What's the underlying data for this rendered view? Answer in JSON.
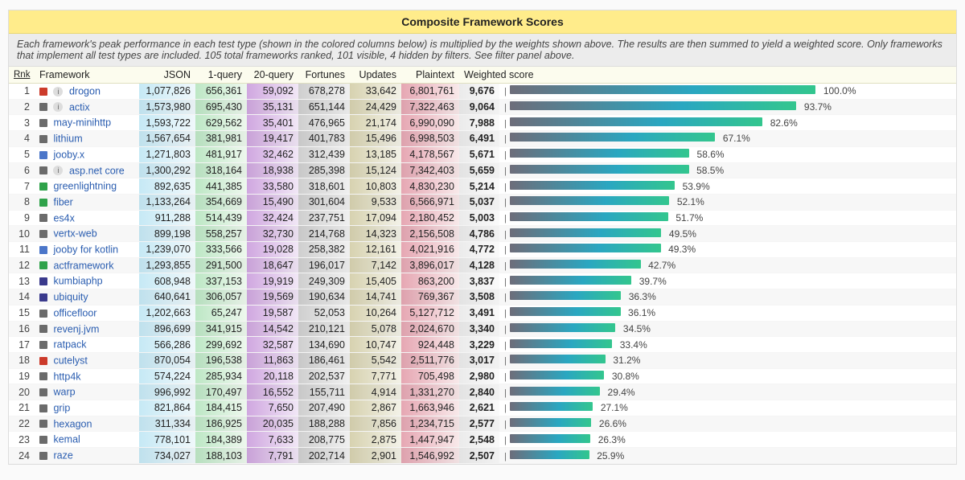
{
  "title": "Composite Framework Scores",
  "description_prefix": "Each framework's peak performance in each test type (shown in the colored columns below) is multiplied by the weights shown above. The results are then summed to yield a weighted score. Only frameworks that implement all test types are included.",
  "description_stats": "105 total frameworks ranked, 101 visible, 4 hidden by filters. See filter panel above.",
  "columns": {
    "rank": "Rnk",
    "framework": "Framework",
    "json": "JSON",
    "one_query": "1-query",
    "twenty_query": "20-query",
    "fortunes": "Fortunes",
    "updates": "Updates",
    "plaintext": "Plaintext",
    "weighted": "Weighted score"
  },
  "chart_data": {
    "type": "bar",
    "title": "Composite Framework Scores",
    "xlabel": "",
    "ylabel": "Weighted score",
    "series_columns": [
      "JSON",
      "1-query",
      "20-query",
      "Fortunes",
      "Updates",
      "Plaintext",
      "Weighted score",
      "Percent"
    ],
    "rows": [
      {
        "rank": 1,
        "swatch": "#cc3b2b",
        "name": "drogon",
        "json": 1077826,
        "one_query": 656361,
        "twenty_query": 59092,
        "fortunes": 678278,
        "updates": 33642,
        "plaintext": 6801761,
        "weighted": 9676,
        "pct": 100.0
      },
      {
        "rank": 2,
        "swatch": "#6b6b6b",
        "name": "actix",
        "json": 1573980,
        "one_query": 695430,
        "twenty_query": 35131,
        "fortunes": 651144,
        "updates": 24429,
        "plaintext": 7322463,
        "weighted": 9064,
        "pct": 93.7
      },
      {
        "rank": 3,
        "swatch": "#6b6b6b",
        "name": "may-minihttp",
        "json": 1593722,
        "one_query": 629562,
        "twenty_query": 35401,
        "fortunes": 476965,
        "updates": 21174,
        "plaintext": 6990090,
        "weighted": 7988,
        "pct": 82.6
      },
      {
        "rank": 4,
        "swatch": "#6b6b6b",
        "name": "lithium",
        "json": 1567654,
        "one_query": 381981,
        "twenty_query": 19417,
        "fortunes": 401783,
        "updates": 15496,
        "plaintext": 6998503,
        "weighted": 6491,
        "pct": 67.1
      },
      {
        "rank": 5,
        "swatch": "#4b76c9",
        "name": "jooby.x",
        "json": 1271803,
        "one_query": 481917,
        "twenty_query": 32462,
        "fortunes": 312439,
        "updates": 13185,
        "plaintext": 4178567,
        "weighted": 5671,
        "pct": 58.6
      },
      {
        "rank": 6,
        "swatch": "#6b6b6b",
        "name": "asp.net core",
        "json": 1300292,
        "one_query": 318164,
        "twenty_query": 18938,
        "fortunes": 285398,
        "updates": 15124,
        "plaintext": 7342403,
        "weighted": 5659,
        "pct": 58.5
      },
      {
        "rank": 7,
        "swatch": "#2fa24a",
        "name": "greenlightning",
        "json": 892635,
        "one_query": 441385,
        "twenty_query": 33580,
        "fortunes": 318601,
        "updates": 10803,
        "plaintext": 4830230,
        "weighted": 5214,
        "pct": 53.9
      },
      {
        "rank": 8,
        "swatch": "#2fa24a",
        "name": "fiber",
        "json": 1133264,
        "one_query": 354669,
        "twenty_query": 15490,
        "fortunes": 301604,
        "updates": 9533,
        "plaintext": 6566971,
        "weighted": 5037,
        "pct": 52.1
      },
      {
        "rank": 9,
        "swatch": "#6b6b6b",
        "name": "es4x",
        "json": 911288,
        "one_query": 514439,
        "twenty_query": 32424,
        "fortunes": 237751,
        "updates": 17094,
        "plaintext": 2180452,
        "weighted": 5003,
        "pct": 51.7
      },
      {
        "rank": 10,
        "swatch": "#6b6b6b",
        "name": "vertx-web",
        "json": 899198,
        "one_query": 558257,
        "twenty_query": 32730,
        "fortunes": 214768,
        "updates": 14323,
        "plaintext": 2156508,
        "weighted": 4786,
        "pct": 49.5
      },
      {
        "rank": 11,
        "swatch": "#4b76c9",
        "name": "jooby for kotlin",
        "json": 1239070,
        "one_query": 333566,
        "twenty_query": 19028,
        "fortunes": 258382,
        "updates": 12161,
        "plaintext": 4021916,
        "weighted": 4772,
        "pct": 49.3
      },
      {
        "rank": 12,
        "swatch": "#2fa24a",
        "name": "actframework",
        "json": 1293855,
        "one_query": 291500,
        "twenty_query": 18647,
        "fortunes": 196017,
        "updates": 7142,
        "plaintext": 3896017,
        "weighted": 4128,
        "pct": 42.7
      },
      {
        "rank": 13,
        "swatch": "#3a3a8c",
        "name": "kumbiaphp",
        "json": 608948,
        "one_query": 337153,
        "twenty_query": 19919,
        "fortunes": 249309,
        "updates": 15405,
        "plaintext": 863200,
        "weighted": 3837,
        "pct": 39.7
      },
      {
        "rank": 14,
        "swatch": "#3a3a8c",
        "name": "ubiquity",
        "json": 640641,
        "one_query": 306057,
        "twenty_query": 19569,
        "fortunes": 190634,
        "updates": 14741,
        "plaintext": 769367,
        "weighted": 3508,
        "pct": 36.3
      },
      {
        "rank": 15,
        "swatch": "#6b6b6b",
        "name": "officefloor",
        "json": 1202663,
        "one_query": 65247,
        "twenty_query": 19587,
        "fortunes": 52053,
        "updates": 10264,
        "plaintext": 5127712,
        "weighted": 3491,
        "pct": 36.1
      },
      {
        "rank": 16,
        "swatch": "#6b6b6b",
        "name": "revenj.jvm",
        "json": 896699,
        "one_query": 341915,
        "twenty_query": 14542,
        "fortunes": 210121,
        "updates": 5078,
        "plaintext": 2024670,
        "weighted": 3340,
        "pct": 34.5
      },
      {
        "rank": 17,
        "swatch": "#6b6b6b",
        "name": "ratpack",
        "json": 566286,
        "one_query": 299692,
        "twenty_query": 32587,
        "fortunes": 134690,
        "updates": 10747,
        "plaintext": 924448,
        "weighted": 3229,
        "pct": 33.4
      },
      {
        "rank": 18,
        "swatch": "#cc3b2b",
        "name": "cutelyst",
        "json": 870054,
        "one_query": 196538,
        "twenty_query": 11863,
        "fortunes": 186461,
        "updates": 5542,
        "plaintext": 2511776,
        "weighted": 3017,
        "pct": 31.2
      },
      {
        "rank": 19,
        "swatch": "#6b6b6b",
        "name": "http4k",
        "json": 574224,
        "one_query": 285934,
        "twenty_query": 20118,
        "fortunes": 202537,
        "updates": 7771,
        "plaintext": 705498,
        "weighted": 2980,
        "pct": 30.8
      },
      {
        "rank": 20,
        "swatch": "#6b6b6b",
        "name": "warp",
        "json": 996992,
        "one_query": 170497,
        "twenty_query": 16552,
        "fortunes": 155711,
        "updates": 4914,
        "plaintext": 1331270,
        "weighted": 2840,
        "pct": 29.4
      },
      {
        "rank": 21,
        "swatch": "#6b6b6b",
        "name": "grip",
        "json": 821864,
        "one_query": 184415,
        "twenty_query": 7650,
        "fortunes": 207490,
        "updates": 2867,
        "plaintext": 1663946,
        "weighted": 2621,
        "pct": 27.1
      },
      {
        "rank": 22,
        "swatch": "#6b6b6b",
        "name": "hexagon",
        "json": 311334,
        "one_query": 186925,
        "twenty_query": 20035,
        "fortunes": 188288,
        "updates": 7856,
        "plaintext": 1234715,
        "weighted": 2577,
        "pct": 26.6
      },
      {
        "rank": 23,
        "swatch": "#6b6b6b",
        "name": "kemal",
        "json": 778101,
        "one_query": 184389,
        "twenty_query": 7633,
        "fortunes": 208775,
        "updates": 2875,
        "plaintext": 1447947,
        "weighted": 2548,
        "pct": 26.3
      },
      {
        "rank": 24,
        "swatch": "#6b6b6b",
        "name": "raze",
        "json": 734027,
        "one_query": 188103,
        "twenty_query": 7791,
        "fortunes": 202714,
        "updates": 2901,
        "plaintext": 1546992,
        "weighted": 2507,
        "pct": 25.9
      }
    ]
  }
}
